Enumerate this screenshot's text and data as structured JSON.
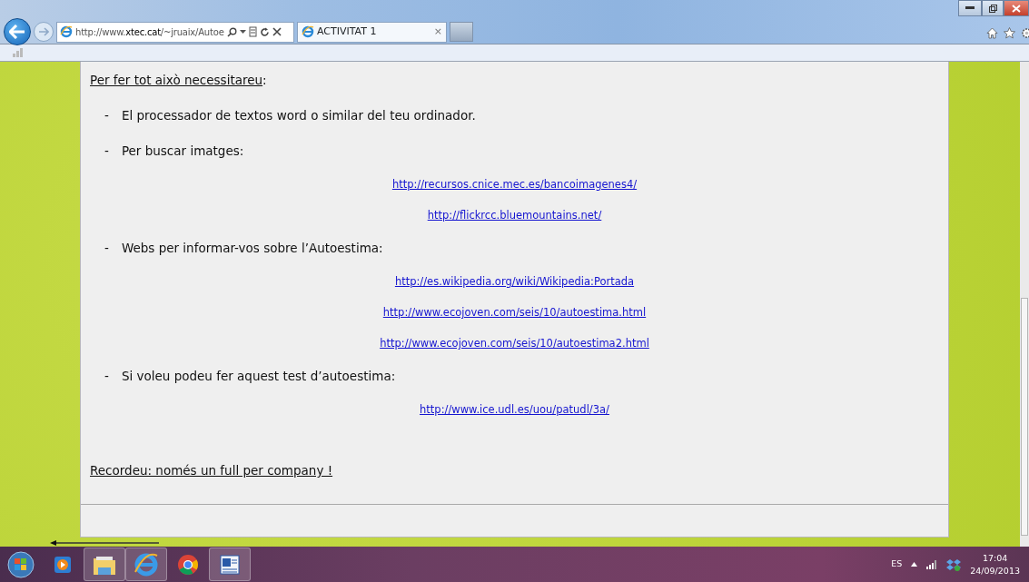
{
  "browser": {
    "address": "http://www.**xtec.cat**/~jruaix/Autoe",
    "tab": {
      "title": "ACTIVITAT 1",
      "close": "×"
    }
  },
  "document": {
    "heading": {
      "text": "Per fer tot això necessitareu",
      "suffix": ":"
    },
    "items": [
      {
        "kind": "bullet",
        "marker": "-",
        "text": "El processador de textos word o similar del teu ordinador."
      },
      {
        "kind": "bullet",
        "marker": "-",
        "text": "Per buscar imatges:"
      },
      {
        "kind": "link",
        "text": "http://recursos.cnice.mec.es/bancoimagenes4/"
      },
      {
        "kind": "link",
        "text": "http://flickrcc.bluemountains.net/"
      },
      {
        "kind": "bullet",
        "marker": "-",
        "text": "Webs per informar-vos sobre l’Autoestima:"
      },
      {
        "kind": "link",
        "text": "http://es.wikipedia.org/wiki/Wikipedia:Portada"
      },
      {
        "kind": "link",
        "text": "http://www.ecojoven.com/seis/10/autoestima.html"
      },
      {
        "kind": "link",
        "text": "http://www.ecojoven.com/seis/10/autoestima2.html"
      },
      {
        "kind": "bullet",
        "marker": "-",
        "text": "Si voleu podeu fer aquest test d’autoestima:"
      },
      {
        "kind": "link",
        "text": "http://www.ice.udl.es/uou/patudl/3a/"
      }
    ],
    "footer_note": "Recordeu: només un full per company !"
  },
  "taskbar": {
    "language": "ES",
    "time": "17:04",
    "date": "24/09/2013"
  }
}
